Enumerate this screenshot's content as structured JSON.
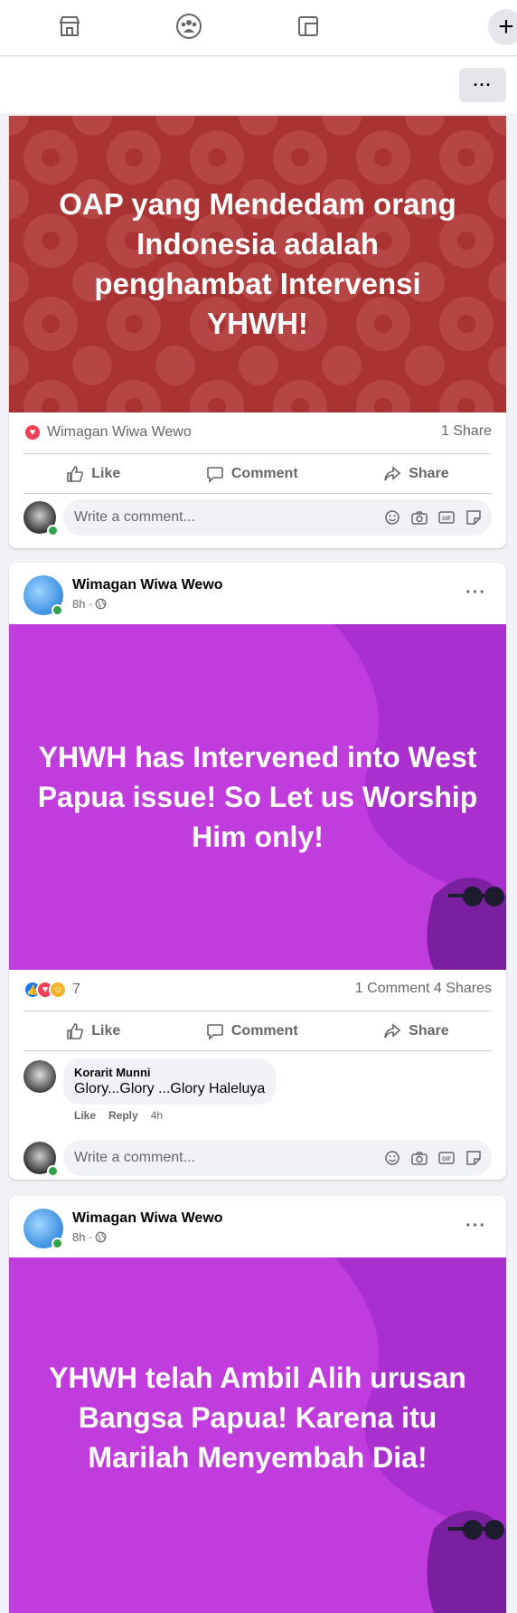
{
  "nav": {
    "icons": [
      "marketplace-icon",
      "groups-icon",
      "feeds-icon",
      "create-icon"
    ],
    "plus": "+"
  },
  "subbar": {
    "more": "···"
  },
  "post1": {
    "banner_text": "OAP yang Mendedam orang Indonesia adalah penghambat Intervensi YHWH!",
    "banner_color": "#a93232",
    "reactor_name": "Wimagan Wiwa Wewo",
    "shares": "1 Share",
    "like": "Like",
    "comment": "Comment",
    "share": "Share",
    "comment_placeholder": "Write a comment..."
  },
  "post2": {
    "author": "Wimagan Wiwa Wewo",
    "time": "8h ·",
    "more": "···",
    "banner_text": "YHWH has Intervened into West Papua issue! So Let us Worship Him only!",
    "banner_color": "#c03cdd",
    "reaction_count": "7",
    "comments": "1 Comment",
    "shares": "4 Shares",
    "like": "Like",
    "comment": "Comment",
    "share": "Share",
    "top_comment": {
      "name": "Korarit Munni",
      "text": "Glory...Glory ...Glory Haleluya",
      "like": "Like",
      "reply": "Reply",
      "time": "4h"
    },
    "comment_placeholder": "Write a comment..."
  },
  "post3": {
    "author": "Wimagan Wiwa Wewo",
    "time": "8h ·",
    "more": "···",
    "banner_text": "YHWH telah Ambil Alih urusan Bangsa Papua! Karena itu Marilah Menyembah Dia!",
    "banner_color": "#c03cdd"
  }
}
